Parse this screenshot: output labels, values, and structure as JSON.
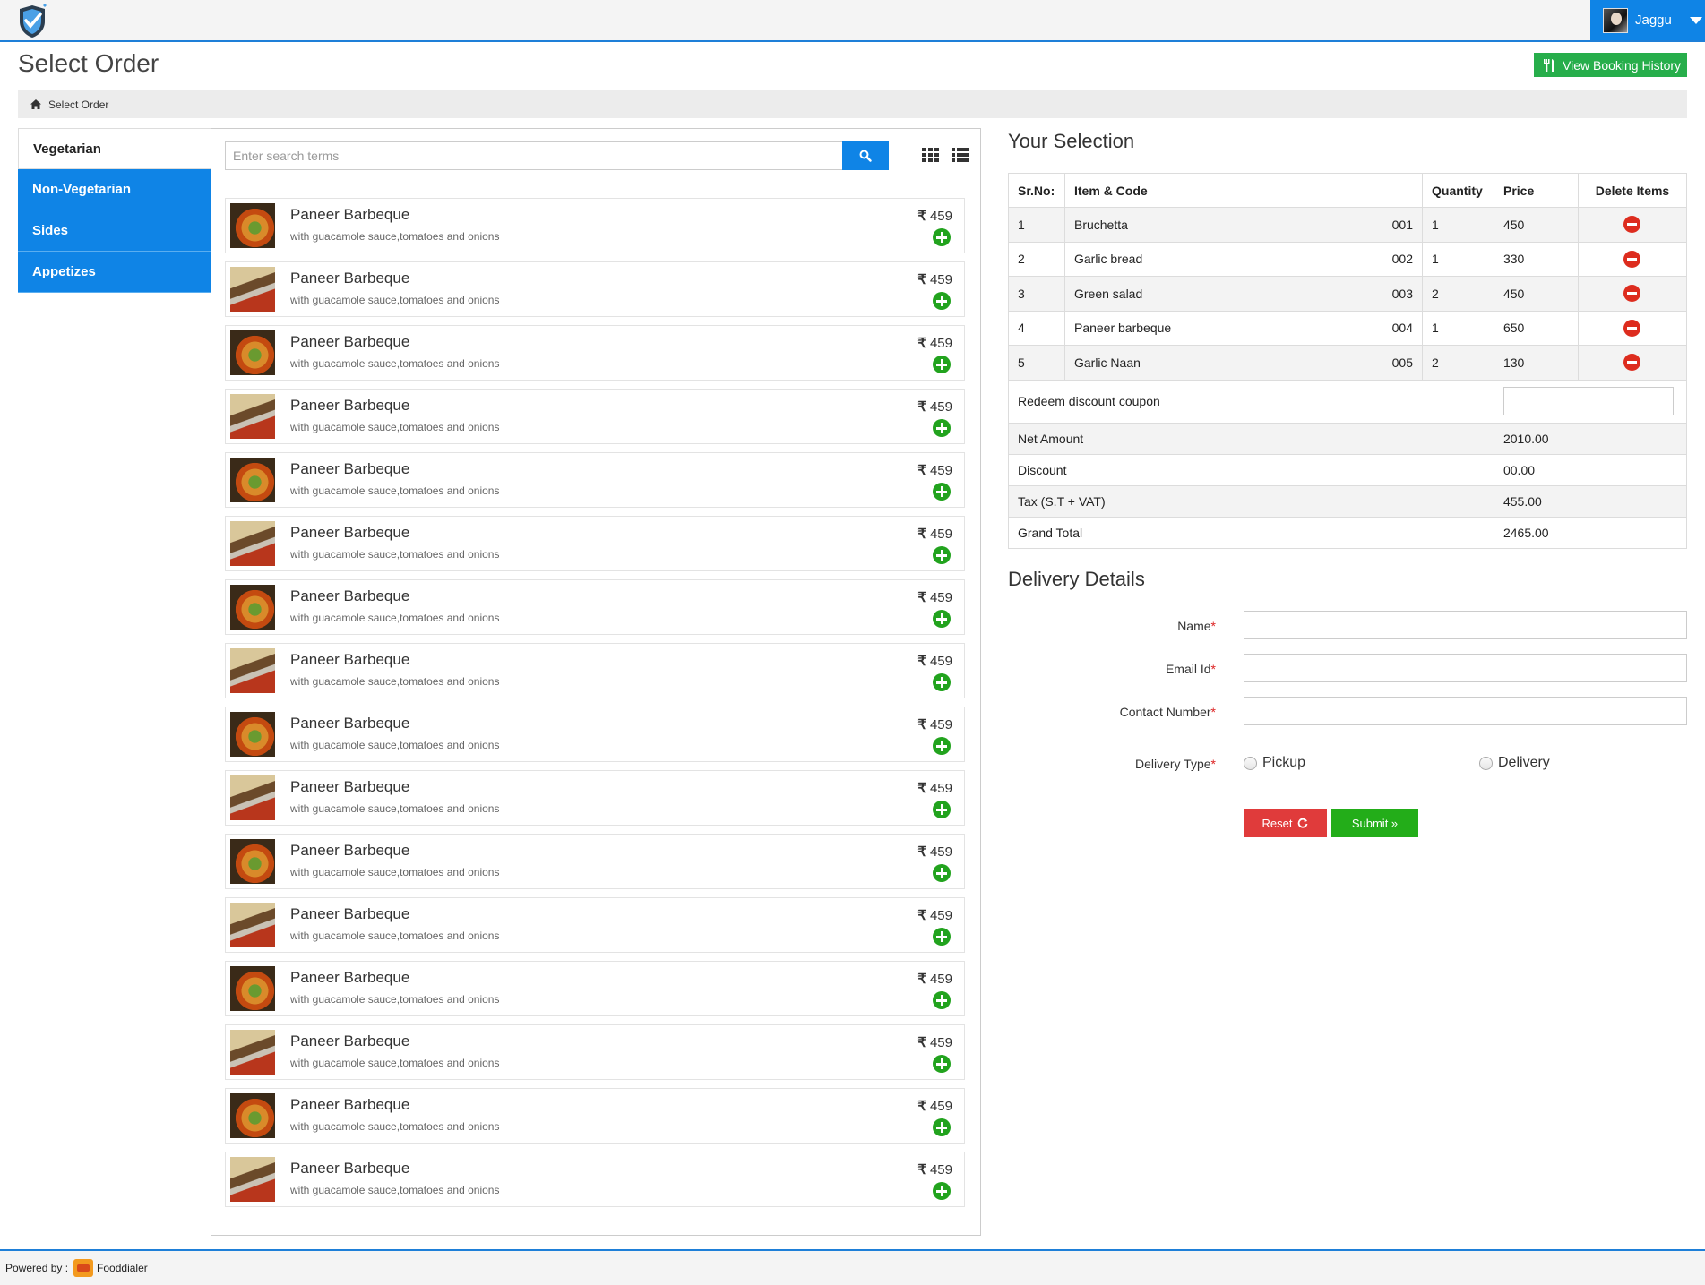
{
  "header": {
    "user_name": "Jaggu"
  },
  "page": {
    "title": "Select Order",
    "history_button": "View Booking History",
    "breadcrumb": "Select Order"
  },
  "categories": [
    {
      "label": "Vegetarian",
      "active": true
    },
    {
      "label": "Non-Vegetarian",
      "active": false
    },
    {
      "label": "Sides",
      "active": false
    },
    {
      "label": "Appetizes",
      "active": false
    }
  ],
  "search": {
    "placeholder": "Enter search terms"
  },
  "menu_items": [
    {
      "name": "Paneer Barbeque",
      "desc": "with guacamole sauce,tomatoes and onions",
      "currency": "₹",
      "price": "459",
      "icon": "food-photo-a"
    },
    {
      "name": "Paneer Barbeque",
      "desc": "with guacamole sauce,tomatoes and onions",
      "currency": "₹",
      "price": "459",
      "icon": "food-photo-b"
    },
    {
      "name": "Paneer Barbeque",
      "desc": "with guacamole sauce,tomatoes and onions",
      "currency": "₹",
      "price": "459",
      "icon": "food-photo-a"
    },
    {
      "name": "Paneer Barbeque",
      "desc": "with guacamole sauce,tomatoes and onions",
      "currency": "₹",
      "price": "459",
      "icon": "food-photo-b"
    },
    {
      "name": "Paneer Barbeque",
      "desc": "with guacamole sauce,tomatoes and onions",
      "currency": "₹",
      "price": "459",
      "icon": "food-photo-a"
    },
    {
      "name": "Paneer Barbeque",
      "desc": "with guacamole sauce,tomatoes and onions",
      "currency": "₹",
      "price": "459",
      "icon": "food-photo-b"
    },
    {
      "name": "Paneer Barbeque",
      "desc": "with guacamole sauce,tomatoes and onions",
      "currency": "₹",
      "price": "459",
      "icon": "food-photo-a"
    },
    {
      "name": "Paneer Barbeque",
      "desc": "with guacamole sauce,tomatoes and onions",
      "currency": "₹",
      "price": "459",
      "icon": "food-photo-b"
    },
    {
      "name": "Paneer Barbeque",
      "desc": "with guacamole sauce,tomatoes and onions",
      "currency": "₹",
      "price": "459",
      "icon": "food-photo-a"
    },
    {
      "name": "Paneer Barbeque",
      "desc": "with guacamole sauce,tomatoes and onions",
      "currency": "₹",
      "price": "459",
      "icon": "food-photo-b"
    },
    {
      "name": "Paneer Barbeque",
      "desc": "with guacamole sauce,tomatoes and onions",
      "currency": "₹",
      "price": "459",
      "icon": "food-photo-a"
    },
    {
      "name": "Paneer Barbeque",
      "desc": "with guacamole sauce,tomatoes and onions",
      "currency": "₹",
      "price": "459",
      "icon": "food-photo-b"
    },
    {
      "name": "Paneer Barbeque",
      "desc": "with guacamole sauce,tomatoes and onions",
      "currency": "₹",
      "price": "459",
      "icon": "food-photo-a"
    },
    {
      "name": "Paneer Barbeque",
      "desc": "with guacamole sauce,tomatoes and onions",
      "currency": "₹",
      "price": "459",
      "icon": "food-photo-b"
    },
    {
      "name": "Paneer Barbeque",
      "desc": "with guacamole sauce,tomatoes and onions",
      "currency": "₹",
      "price": "459",
      "icon": "food-photo-a"
    },
    {
      "name": "Paneer Barbeque",
      "desc": "with guacamole sauce,tomatoes and onions",
      "currency": "₹",
      "price": "459",
      "icon": "food-photo-b"
    }
  ],
  "selection": {
    "title": "Your Selection",
    "headers": [
      "Sr.No:",
      "Item & Code",
      "Quantity",
      "Price",
      "Delete Items"
    ],
    "rows": [
      {
        "sr": "1",
        "item": "Bruchetta",
        "code": "001",
        "qty": "1",
        "price": "450"
      },
      {
        "sr": "2",
        "item": "Garlic bread",
        "code": "002",
        "qty": "1",
        "price": "330"
      },
      {
        "sr": "3",
        "item": "Green salad",
        "code": "003",
        "qty": "2",
        "price": "450"
      },
      {
        "sr": "4",
        "item": "Paneer barbeque",
        "code": "004",
        "qty": "1",
        "price": "650"
      },
      {
        "sr": "5",
        "item": "Garlic Naan",
        "code": "005",
        "qty": "2",
        "price": "130"
      }
    ],
    "coupon_label": "Redeem discount coupon",
    "coupon_value": "",
    "summary": [
      {
        "label": "Net Amount",
        "value": "2010.00"
      },
      {
        "label": "Discount",
        "value": "00.00"
      },
      {
        "label": "Tax (S.T + VAT)",
        "value": "455.00"
      },
      {
        "label": "Grand Total",
        "value": "2465.00"
      }
    ]
  },
  "delivery": {
    "title": "Delivery Details",
    "name_label": "Name",
    "email_label": "Email Id",
    "contact_label": "Contact Number",
    "type_label": "Delivery Type",
    "required_mark": "*",
    "name_value": "",
    "email_value": "",
    "contact_value": "",
    "option_pickup": "Pickup",
    "option_delivery": "Delivery",
    "reset_label": "Reset",
    "submit_label": "Submit »"
  },
  "footer": {
    "powered_by": "Powered by :",
    "brand": "Fooddialer"
  },
  "colors": {
    "primary_blue": "#0f84e6",
    "success_green": "#27ae4b",
    "danger_red": "#e03b3b",
    "add_green": "#22a31e"
  }
}
